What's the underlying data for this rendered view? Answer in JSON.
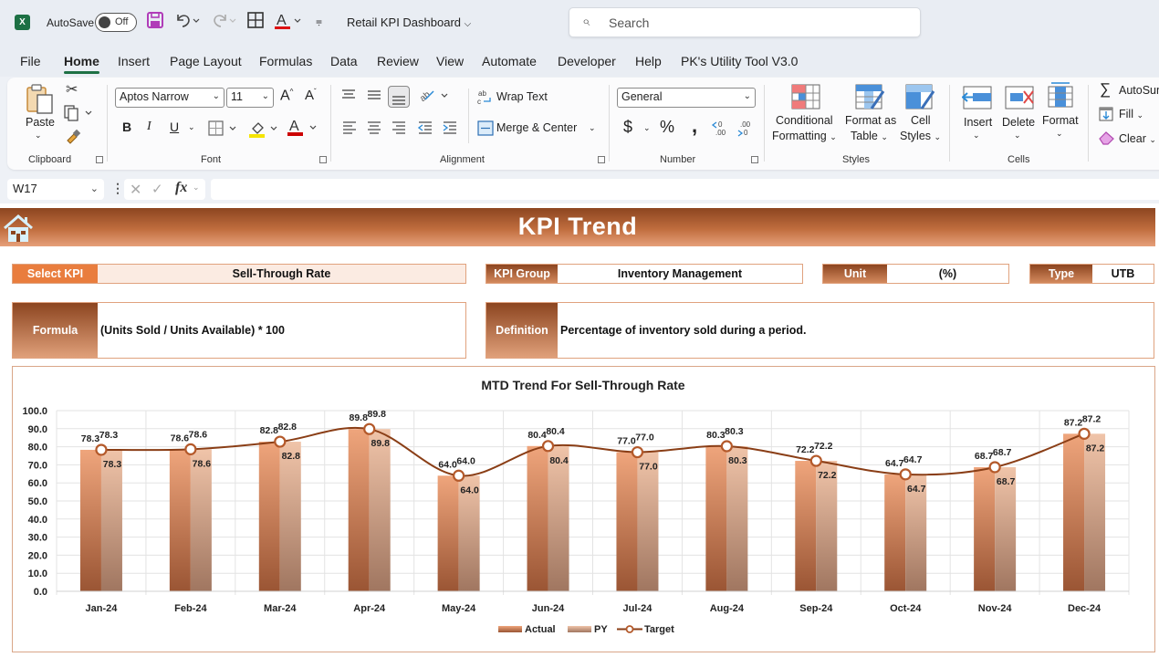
{
  "titlebar": {
    "app_icon": "excel-icon",
    "autosave_label": "AutoSave",
    "autosave_state": "Off",
    "document_title": "Retail KPI Dashboard",
    "search_placeholder": "Search"
  },
  "menu": {
    "tabs": [
      "File",
      "Home",
      "Insert",
      "Page Layout",
      "Formulas",
      "Data",
      "Review",
      "View",
      "Automate",
      "Developer",
      "Help",
      "PK's Utility Tool V3.0"
    ],
    "active": "Home"
  },
  "ribbon": {
    "clipboard": {
      "paste": "Paste",
      "label": "Clipboard"
    },
    "font": {
      "name": "Aptos Narrow",
      "size": "11",
      "bold": "B",
      "italic": "I",
      "underline": "U",
      "label": "Font"
    },
    "alignment": {
      "wrap_text": "Wrap Text",
      "merge_center": "Merge & Center",
      "label": "Alignment"
    },
    "number": {
      "format": "General",
      "currency": "$",
      "percent": "%",
      "comma": ",",
      "label": "Number"
    },
    "styles": {
      "conditional_1": "Conditional",
      "conditional_2": "Formatting",
      "format_table_1": "Format as",
      "format_table_2": "Table",
      "cell_styles_1": "Cell",
      "cell_styles_2": "Styles",
      "label": "Styles"
    },
    "cells": {
      "insert": "Insert",
      "delete": "Delete",
      "format": "Format",
      "label": "Cells"
    },
    "editing": {
      "autosum": "AutoSum",
      "fill": "Fill",
      "clear": "Clear"
    }
  },
  "formula_bar": {
    "name_box": "W17",
    "fx": "fx",
    "formula": ""
  },
  "dashboard": {
    "title": "KPI Trend",
    "select_kpi_label": "Select KPI",
    "select_kpi_value": "Sell-Through Rate",
    "kpi_group_label": "KPI Group",
    "kpi_group_value": "Inventory Management",
    "unit_label": "Unit",
    "unit_value": "(%)",
    "type_label": "Type",
    "type_value": "UTB",
    "formula_label": "Formula",
    "formula_value": "(Units Sold / Units Available) * 100",
    "definition_label": "Definition",
    "definition_value": "Percentage of inventory sold during a period."
  },
  "colors": {
    "actual": "#d98a5c",
    "py": "#e6b59a",
    "target_line": "#8a3e16",
    "banner_dark": "#8c4520",
    "banner_light": "#e6a07a",
    "select_label": "#e97d3e"
  },
  "chart_data": {
    "type": "bar",
    "title": "MTD Trend For Sell-Through Rate",
    "xlabel": "",
    "ylabel": "",
    "ylim": [
      0,
      100
    ],
    "yticks": [
      "0.0",
      "10.0",
      "20.0",
      "30.0",
      "40.0",
      "50.0",
      "60.0",
      "70.0",
      "80.0",
      "90.0",
      "100.0"
    ],
    "grid": true,
    "legend_position": "bottom",
    "categories": [
      "Jan-24",
      "Feb-24",
      "Mar-24",
      "Apr-24",
      "May-24",
      "Jun-24",
      "Jul-24",
      "Aug-24",
      "Sep-24",
      "Oct-24",
      "Nov-24",
      "Dec-24"
    ],
    "series": [
      {
        "name": "Actual",
        "type": "bar",
        "values": [
          78.3,
          78.6,
          82.8,
          89.8,
          64.0,
          80.4,
          77.0,
          80.3,
          72.2,
          64.7,
          68.7,
          87.2
        ]
      },
      {
        "name": "PY",
        "type": "bar",
        "values": [
          78.3,
          78.6,
          82.8,
          89.8,
          64.0,
          80.4,
          77.0,
          80.3,
          72.2,
          64.7,
          68.7,
          87.2
        ]
      },
      {
        "name": "Target",
        "type": "line",
        "values": [
          78.3,
          78.6,
          82.8,
          89.8,
          64.0,
          80.4,
          77.0,
          80.3,
          72.2,
          64.7,
          68.7,
          87.2
        ]
      }
    ]
  }
}
